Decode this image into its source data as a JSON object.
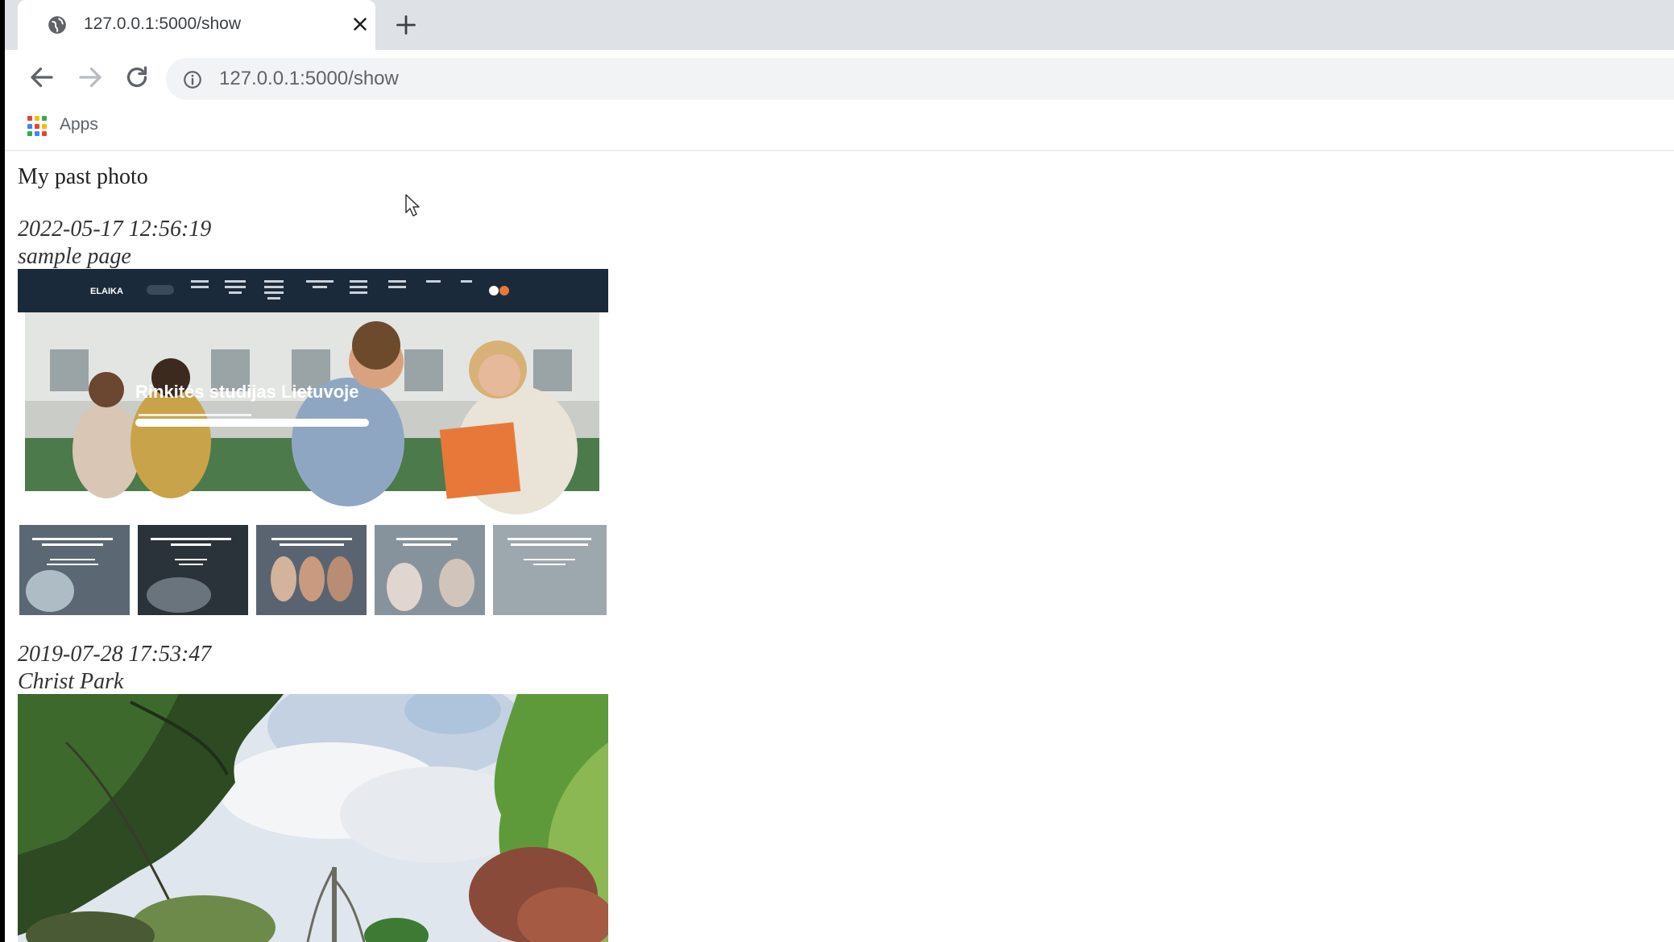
{
  "browser": {
    "tab_title": "127.0.0.1:5000/show",
    "url": "127.0.0.1:5000/show",
    "bookmarks": [
      {
        "label": "Apps",
        "icon": "apps-grid-icon"
      }
    ]
  },
  "page": {
    "heading": "My past photo",
    "entries": [
      {
        "timestamp": "2022-05-17 12:56:19",
        "title": "sample page",
        "screenshot": {
          "brand": "ELAIKA",
          "hero_text": "Rinkitės studijas Lietuvoje",
          "card_count": 5
        }
      },
      {
        "timestamp": "2019-07-28 17:53:47",
        "title": "Christ Park"
      }
    ]
  },
  "colors": {
    "tabstrip": "#dee1e6",
    "omnibox": "#f1f3f4",
    "site_nav": "#1b2a3a",
    "accent_orange": "#e8783a"
  }
}
